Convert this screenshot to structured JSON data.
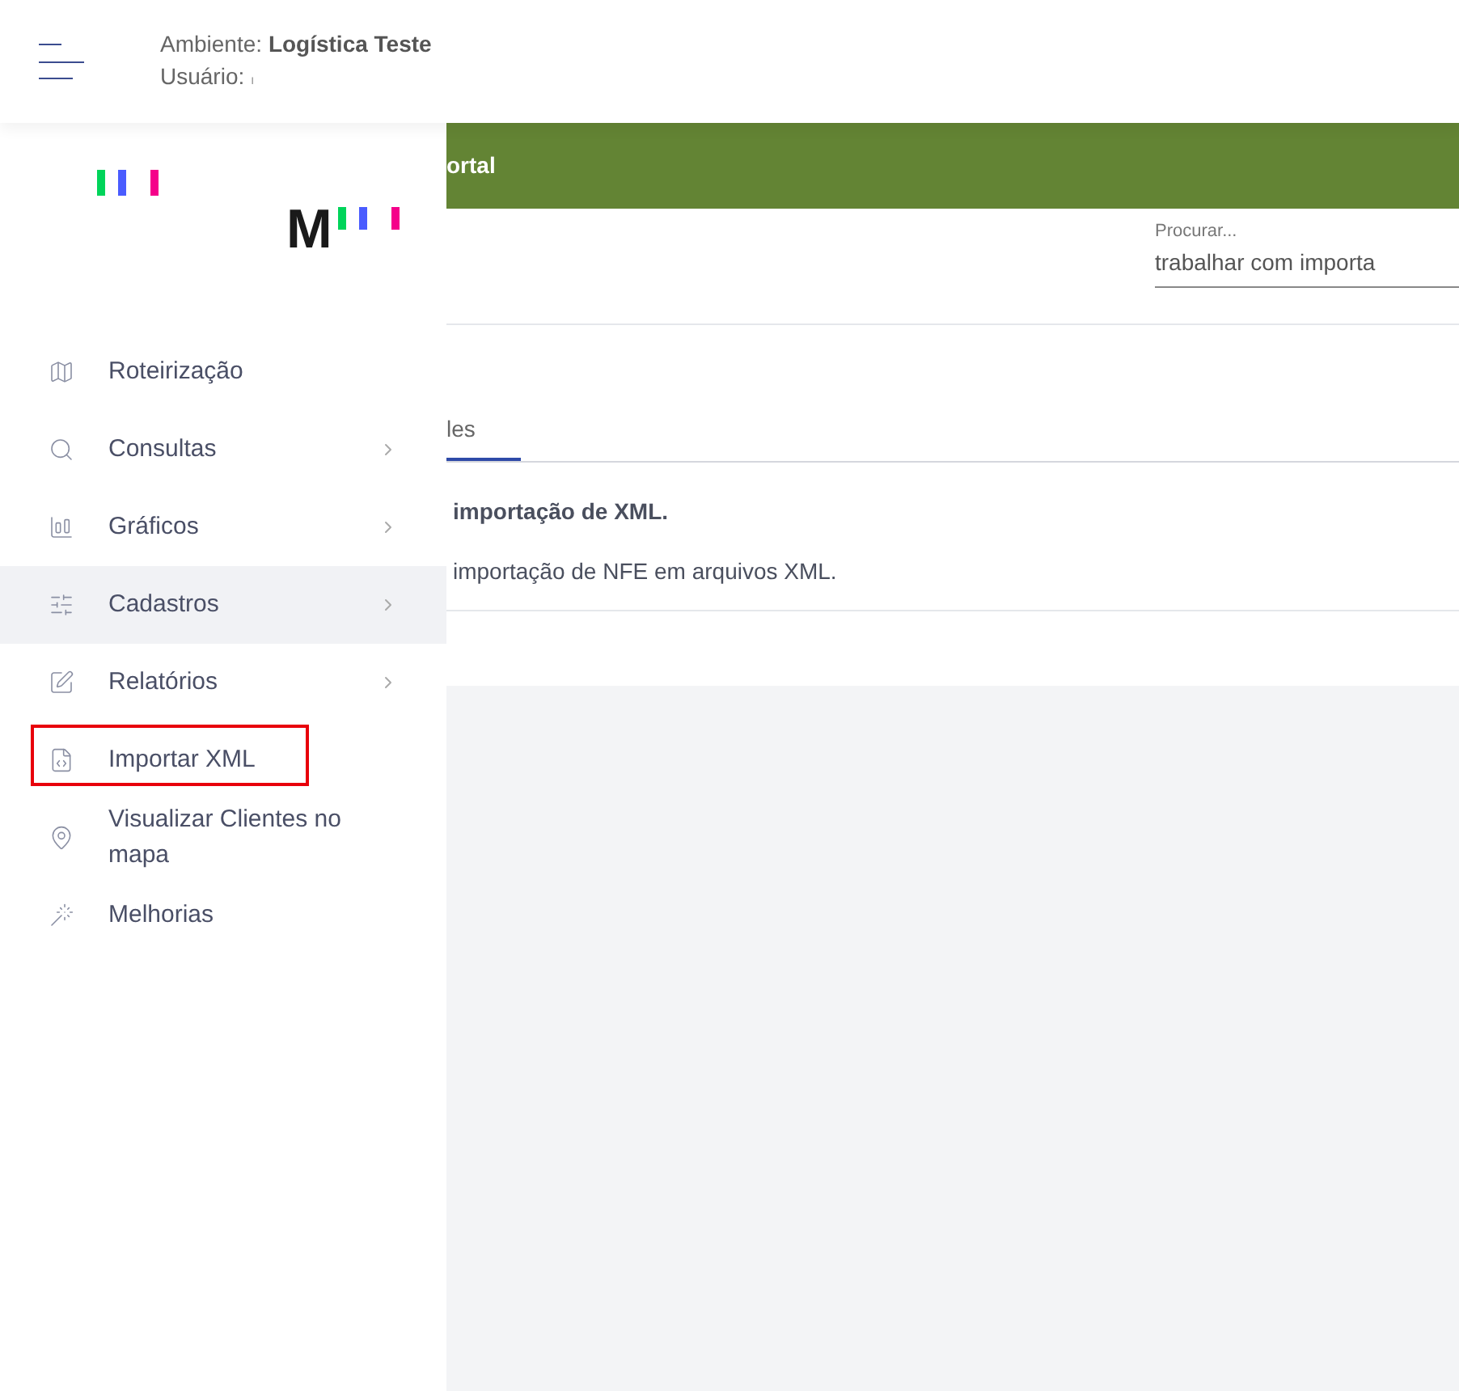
{
  "header": {
    "environment_label": "Ambiente:",
    "environment": "Logística Teste",
    "user_label": "Usuário:",
    "user": "ı"
  },
  "logo": {
    "letter": "M"
  },
  "sidebar": {
    "items": [
      {
        "label": "Roteirização",
        "has_submenu": false,
        "selected": false,
        "highlighted": false
      },
      {
        "label": "Consultas",
        "has_submenu": true,
        "selected": false,
        "highlighted": false
      },
      {
        "label": "Gráficos",
        "has_submenu": true,
        "selected": false,
        "highlighted": false
      },
      {
        "label": "Cadastros",
        "has_submenu": true,
        "selected": true,
        "highlighted": false
      },
      {
        "label": "Relatórios",
        "has_submenu": true,
        "selected": false,
        "highlighted": false
      },
      {
        "label": "Importar XML",
        "has_submenu": false,
        "selected": false,
        "highlighted": true
      },
      {
        "label": "Visualizar Clientes no mapa",
        "has_submenu": false,
        "selected": false,
        "highlighted": false
      },
      {
        "label": "Melhorias",
        "has_submenu": false,
        "selected": false,
        "highlighted": false
      }
    ]
  },
  "banner": {
    "title": "ortal"
  },
  "search": {
    "label": "Procurar...",
    "value": "trabalhar com importa"
  },
  "tabs": [
    {
      "label": "les",
      "selected": true
    }
  ],
  "result": {
    "title": "importação de XML.",
    "description": "importação de NFE em arquivos XML."
  }
}
